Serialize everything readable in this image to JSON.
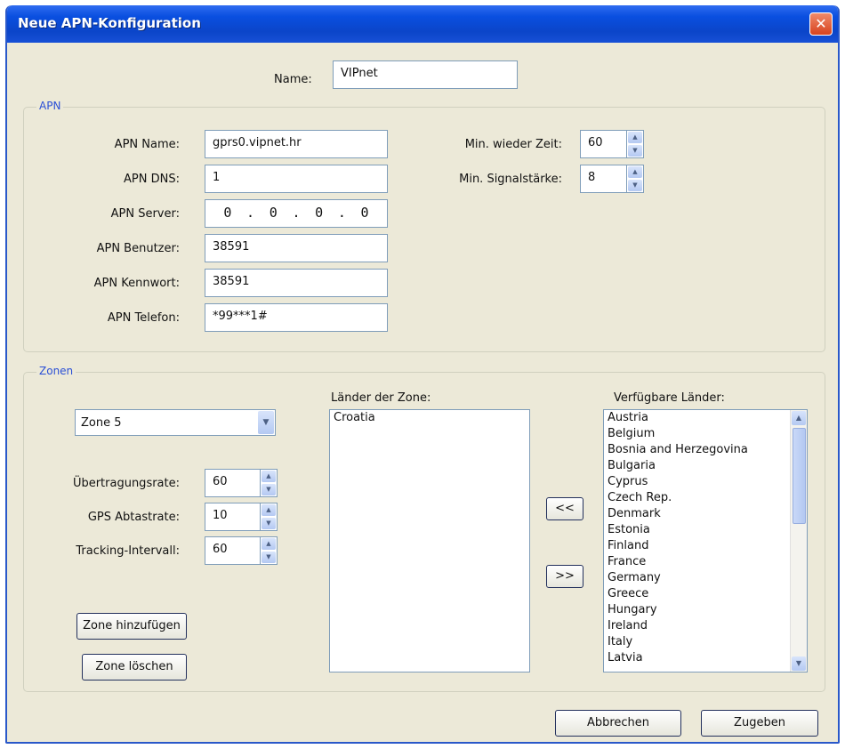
{
  "window": {
    "title": "Neue APN-Konfiguration",
    "close_symbol": "✕"
  },
  "name": {
    "label": "Name:",
    "value": "VIPnet"
  },
  "apn": {
    "group_title": "APN",
    "name_label": "APN Name:",
    "name_value": "gprs0.vipnet.hr",
    "dns_label": "APN DNS:",
    "dns_value": "1",
    "server_label": "APN Server:",
    "server_octets": [
      "0",
      ".",
      "0",
      ".",
      "0",
      ".",
      "0"
    ],
    "user_label": "APN Benutzer:",
    "user_value": "38591",
    "password_label": "APN Kennwort:",
    "password_value": "38591",
    "phone_label": "APN Telefon:",
    "phone_value": "*99***1#",
    "min_time_label": "Min. wieder Zeit:",
    "min_time_value": "60",
    "min_signal_label": "Min. Signalstärke:",
    "min_signal_value": "8"
  },
  "zones": {
    "group_title": "Zonen",
    "selected_zone": "Zone 5",
    "rate_label": "Übertragungsrate:",
    "rate_value": "60",
    "gps_label": "GPS Abtastrate:",
    "gps_value": "10",
    "tracking_label": "Tracking-Intervall:",
    "tracking_value": "60",
    "add_zone_label": "Zone hinzufügen",
    "delete_zone_label": "Zone löschen",
    "zone_countries_label": "Länder der Zone:",
    "zone_countries": [
      "Croatia"
    ],
    "available_label": "Verfügbare Länder:",
    "available_countries": [
      "Austria",
      "Belgium",
      "Bosnia and Herzegovina",
      "Bulgaria",
      "Cyprus",
      "Czech Rep.",
      "Denmark",
      "Estonia",
      "Finland",
      "France",
      "Germany",
      "Greece",
      "Hungary",
      "Ireland",
      "Italy",
      "Latvia"
    ],
    "move_left_label": "<<",
    "move_right_label": ">>"
  },
  "footer": {
    "cancel_label": "Abbrechen",
    "submit_label": "Zugeben"
  },
  "icons": {
    "spin_up": "▲",
    "spin_down": "▼",
    "dropdown": "▼"
  }
}
